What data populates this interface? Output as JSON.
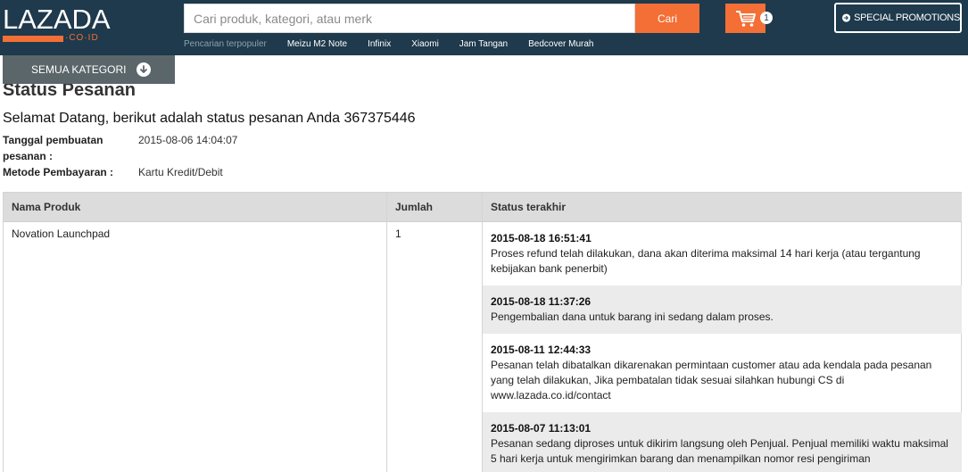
{
  "header": {
    "logo": {
      "word": "LAZADA",
      "tld": "·CO·ID"
    },
    "search": {
      "placeholder": "Cari produk, kategori, atau merk",
      "button_label": "Cari"
    },
    "popular": {
      "label": "Pencarian terpopuler",
      "links": [
        "Meizu M2 Note",
        "Infinix",
        "Xiaomi",
        "Jam Tangan",
        "Bedcover Murah"
      ]
    },
    "cart": {
      "count": "1",
      "icon": "cart-icon"
    },
    "promo": {
      "label": "SPECIAL PROMOTIONS",
      "icon": "arrow-circle-icon"
    },
    "kategori": {
      "label": "SEMUA KATEGORI",
      "icon": "arrow-down-circle-icon"
    }
  },
  "page": {
    "title": "Status Pesanan",
    "welcome": "Selamat Datang, berikut adalah status pesanan Anda 367375446",
    "meta": {
      "created_label_line1": "Tanggal pembuatan",
      "created_label_line2": "pesanan :",
      "created_value": "2015-08-06 14:04:07",
      "payment_label": "Metode Pembayaran :",
      "payment_value": "Kartu Kredit/Debit"
    }
  },
  "table": {
    "headers": [
      "Nama Produk",
      "Jumlah",
      "Status terakhir"
    ],
    "row": {
      "product": "Novation Launchpad",
      "quantity": "1",
      "statuses": [
        {
          "date": "2015-08-18 16:51:41",
          "text": "Proses refund telah dilakukan, dana akan diterima maksimal 14 hari kerja (atau tergantung kebijakan bank penerbit)"
        },
        {
          "date": "2015-08-18 11:37:26",
          "text": "Pengembalian dana untuk barang ini sedang dalam proses."
        },
        {
          "date": "2015-08-11 12:44:33",
          "text": "Pesanan telah dibatalkan dikarenakan permintaan customer atau ada kendala pada pesanan yang telah dilakukan, Jika pembatalan tidak sesuai silahkan hubungi CS di www.lazada.co.id/contact"
        },
        {
          "date": "2015-08-07 11:13:01",
          "text": "Pesanan sedang diproses untuk dikirim langsung oleh Penjual. Penjual memiliki waktu maksimal 5 hari kerja untuk mengirimkan barang dan menampilkan nomor resi pengiriman"
        }
      ]
    }
  },
  "colors": {
    "header_bg": "#1e3a4c",
    "accent": "#f36f36",
    "kategori_bg": "#5a666a",
    "table_header_bg": "#dcdcdc",
    "status_alt_bg": "#ebebeb"
  }
}
